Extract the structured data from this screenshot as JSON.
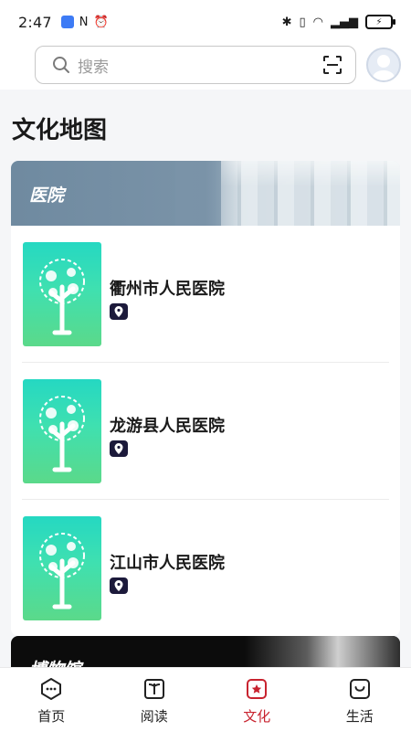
{
  "status_bar": {
    "time": "2:47",
    "battery_symbol": "⚡"
  },
  "search": {
    "placeholder": "搜索"
  },
  "page": {
    "title": "文化地图"
  },
  "categories": [
    {
      "label": "医院",
      "items": [
        {
          "name": "衢州市人民医院"
        },
        {
          "name": "龙游县人民医院"
        },
        {
          "name": "江山市人民医院"
        }
      ]
    },
    {
      "label": "博物馆"
    }
  ],
  "bottom_nav": {
    "active": "文化",
    "items": [
      {
        "label": "首页",
        "icon": "home-chat-icon"
      },
      {
        "label": "阅读",
        "icon": "book-icon"
      },
      {
        "label": "文化",
        "icon": "star-badge-icon"
      },
      {
        "label": "生活",
        "icon": "bag-smile-icon"
      }
    ]
  },
  "colors": {
    "accent": "#c8232f",
    "thumb_start": "#25d8c2",
    "thumb_end": "#5bd98a",
    "banner": "#7a93a8"
  }
}
